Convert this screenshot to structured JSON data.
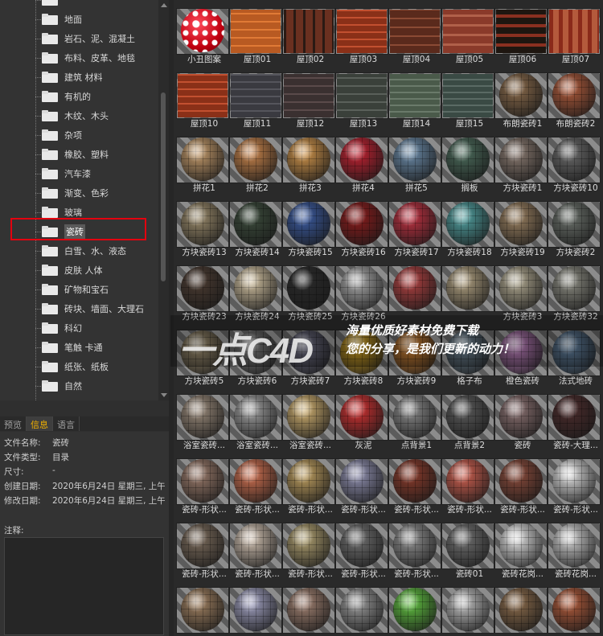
{
  "tree": {
    "items": [
      {
        "label": "",
        "icon": "folder-icon"
      },
      {
        "label": "地面",
        "icon": "folder-icon"
      },
      {
        "label": "岩石、泥、混凝土",
        "icon": "folder-icon"
      },
      {
        "label": "布料、皮革、地毯",
        "icon": "folder-icon"
      },
      {
        "label": "建筑 材料",
        "icon": "folder-icon"
      },
      {
        "label": "有机的",
        "icon": "folder-icon"
      },
      {
        "label": "木纹、木头",
        "icon": "folder-icon"
      },
      {
        "label": "杂项",
        "icon": "folder-icon"
      },
      {
        "label": "橡胶、塑料",
        "icon": "folder-icon"
      },
      {
        "label": "汽车漆",
        "icon": "folder-icon"
      },
      {
        "label": "渐变、色彩",
        "icon": "folder-icon"
      },
      {
        "label": "玻璃",
        "icon": "folder-icon"
      },
      {
        "label": "瓷砖",
        "icon": "folder-icon",
        "selected": true
      },
      {
        "label": "白雪、水、液态",
        "icon": "folder-icon"
      },
      {
        "label": "皮肤 人体",
        "icon": "folder-icon"
      },
      {
        "label": "矿物和宝石",
        "icon": "folder-icon"
      },
      {
        "label": "砖块、墙面、大理石",
        "icon": "folder-icon"
      },
      {
        "label": "科幻",
        "icon": "folder-icon"
      },
      {
        "label": "笔触 卡通",
        "icon": "folder-icon"
      },
      {
        "label": "纸张、纸板",
        "icon": "folder-icon"
      },
      {
        "label": "自然",
        "icon": "folder-icon"
      }
    ],
    "highlight_color": "#e3000f"
  },
  "info": {
    "tabs": [
      {
        "label": "预览",
        "active": false
      },
      {
        "label": "信息",
        "active": true
      },
      {
        "label": "语言",
        "active": false
      }
    ],
    "rows": [
      {
        "label": "文件名称:",
        "value": "瓷砖"
      },
      {
        "label": "文件类型:",
        "value": "目录"
      },
      {
        "label": "尺寸:",
        "value": "-"
      },
      {
        "label": "创建日期:",
        "value": "2020年6月24日 星期三, 上午"
      },
      {
        "label": "修改日期:",
        "value": "2020年6月24日 星期三, 上午"
      }
    ],
    "notes_label": "注释:"
  },
  "materials": [
    {
      "name": "小丑图案"
    },
    {
      "name": "屋顶01"
    },
    {
      "name": "屋顶02"
    },
    {
      "name": "屋顶03"
    },
    {
      "name": "屋顶04"
    },
    {
      "name": "屋顶05"
    },
    {
      "name": "屋顶06"
    },
    {
      "name": "屋顶07"
    },
    {
      "name": "屋顶10"
    },
    {
      "name": "屋顶11"
    },
    {
      "name": "屋顶12"
    },
    {
      "name": "屋顶13"
    },
    {
      "name": "屋顶14"
    },
    {
      "name": "屋顶15"
    },
    {
      "name": "布朗瓷砖1"
    },
    {
      "name": "布朗瓷砖2"
    },
    {
      "name": "拼花1"
    },
    {
      "name": "拼花2"
    },
    {
      "name": "拼花3"
    },
    {
      "name": "拼花4"
    },
    {
      "name": "拼花5"
    },
    {
      "name": "搁板"
    },
    {
      "name": "方块瓷砖1"
    },
    {
      "name": "方块瓷砖10"
    },
    {
      "name": "方块瓷砖13"
    },
    {
      "name": "方块瓷砖14"
    },
    {
      "name": "方块瓷砖15"
    },
    {
      "name": "方块瓷砖16"
    },
    {
      "name": "方块瓷砖17"
    },
    {
      "name": "方块瓷砖18"
    },
    {
      "name": "方块瓷砖19"
    },
    {
      "name": "方块瓷砖2"
    },
    {
      "name": "方块瓷砖23"
    },
    {
      "name": "方块瓷砖24"
    },
    {
      "name": "方块瓷砖25"
    },
    {
      "name": "方块瓷砖26"
    },
    {
      "name": ""
    },
    {
      "name": ""
    },
    {
      "name": "方块瓷砖3"
    },
    {
      "name": "方块瓷砖32"
    },
    {
      "name": "方块瓷砖5"
    },
    {
      "name": "方块瓷砖6"
    },
    {
      "name": "方块瓷砖7"
    },
    {
      "name": "方块瓷砖8"
    },
    {
      "name": "方块瓷砖9"
    },
    {
      "name": "格子布"
    },
    {
      "name": "橙色瓷砖"
    },
    {
      "name": "法式地砖"
    },
    {
      "name": "浴室瓷砖..."
    },
    {
      "name": "浴室瓷砖..."
    },
    {
      "name": "浴室瓷砖..."
    },
    {
      "name": "灰泥"
    },
    {
      "name": "点背景1"
    },
    {
      "name": "点背景2"
    },
    {
      "name": "瓷砖"
    },
    {
      "name": "瓷砖-大理..."
    },
    {
      "name": "瓷砖-形状..."
    },
    {
      "name": "瓷砖-形状..."
    },
    {
      "name": "瓷砖-形状..."
    },
    {
      "name": "瓷砖-形状..."
    },
    {
      "name": "瓷砖-形状..."
    },
    {
      "name": "瓷砖-形状..."
    },
    {
      "name": "瓷砖-形状..."
    },
    {
      "name": "瓷砖-形状..."
    },
    {
      "name": "瓷砖-形状..."
    },
    {
      "name": "瓷砖-形状..."
    },
    {
      "name": "瓷砖-形状..."
    },
    {
      "name": "瓷砖-形状..."
    },
    {
      "name": "瓷砖-形状..."
    },
    {
      "name": "瓷砖01"
    },
    {
      "name": "瓷砖花岗..."
    },
    {
      "name": "瓷砖花岗..."
    },
    {
      "name": ""
    },
    {
      "name": ""
    },
    {
      "name": ""
    },
    {
      "name": ""
    },
    {
      "name": ""
    },
    {
      "name": ""
    },
    {
      "name": ""
    },
    {
      "name": ""
    }
  ],
  "watermark": {
    "logo": "一点C4D",
    "line1": "海量优质好素材免费下载",
    "line2": "您的分享，是我们更新的动力！"
  }
}
